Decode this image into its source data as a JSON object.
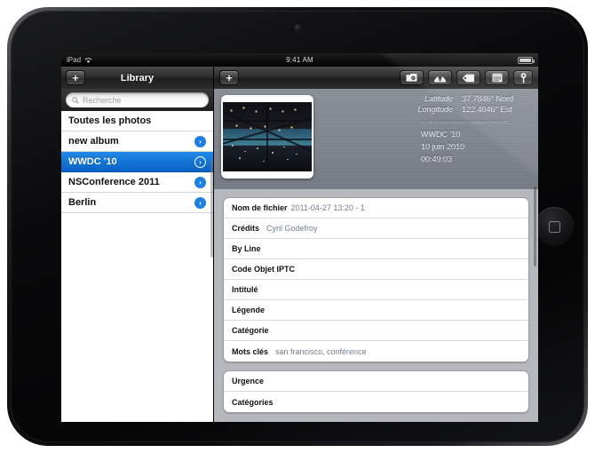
{
  "device": {
    "name": "ipad",
    "home_button": "home-button"
  },
  "status_bar": {
    "carrier": "iPad",
    "wifi_icon": "wifi-icon",
    "time": "9:41 AM",
    "battery_icon": "battery-icon"
  },
  "left_toolbar": {
    "add_label": "+",
    "title": "Library"
  },
  "right_toolbar": {
    "add_label": "+",
    "icons": [
      {
        "name": "camera-import-icon"
      },
      {
        "name": "upload-cloud-icon"
      },
      {
        "name": "tag-icon"
      },
      {
        "name": "calendar-icon"
      },
      {
        "name": "map-pin-icon"
      }
    ]
  },
  "sidebar": {
    "search": {
      "placeholder": "Recherche",
      "value": "",
      "icon": "search-icon"
    },
    "albums": [
      {
        "label": "Toutes les photos",
        "disclosure": false,
        "selected": false
      },
      {
        "label": "new album",
        "disclosure": true,
        "selected": false
      },
      {
        "label": "WWDC '10",
        "disclosure": true,
        "selected": true
      },
      {
        "label": "NSConference 2011",
        "disclosure": true,
        "selected": false
      },
      {
        "label": "Berlin",
        "disclosure": true,
        "selected": false
      }
    ],
    "disclosure_glyph": "›"
  },
  "detail_header": {
    "thumbnail_name": "photo-thumbnail",
    "geo": [
      {
        "label": "Latitude",
        "value": "37.7846° Nord"
      },
      {
        "label": "Longitude",
        "value": "122.4046° Est"
      }
    ],
    "address": "84 4th St, San Francisco, Californie 94103, Ét...",
    "album": "WWDC '10",
    "date": "10 juin 2010",
    "time": "00:49:03"
  },
  "metadata_form": {
    "groups": [
      {
        "rows": [
          {
            "label": "Nom de fichier",
            "value": "2011-04-27 13:20 - 1",
            "tight": true
          },
          {
            "label": "Crédits",
            "value": "Cyril Godefroy",
            "tight": false
          },
          {
            "label": "By Line",
            "value": "",
            "tight": false
          },
          {
            "label": "Code Objet IPTC",
            "value": "",
            "tight": false
          },
          {
            "label": "Intitulé",
            "value": "",
            "tight": false
          },
          {
            "label": "Légende",
            "value": "",
            "tight": false
          },
          {
            "label": "Catégorie",
            "value": "",
            "tight": false
          },
          {
            "label": "Mots clés",
            "value": "san francisco, conférence",
            "tight": false
          }
        ]
      },
      {
        "rows": [
          {
            "label": "Urgence",
            "value": "",
            "tight": false
          },
          {
            "label": "Catégories",
            "value": "",
            "tight": false
          }
        ]
      }
    ]
  },
  "colors": {
    "selection_blue": "#1f89e8",
    "disclosure_blue": "#1d7fe0",
    "value_text": "#6f7d91",
    "form_bg": "#b5b8bd"
  }
}
